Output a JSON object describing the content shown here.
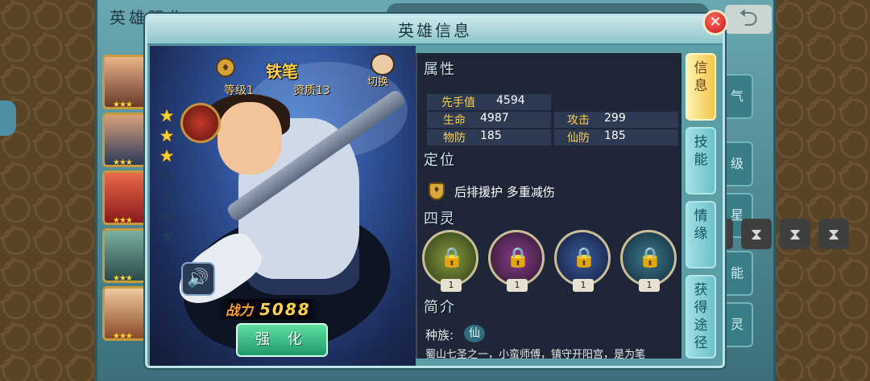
{
  "background_screen": {
    "title": "英雄强化",
    "side_labels": [
      "气",
      "级",
      "星",
      "能",
      "灵"
    ]
  },
  "dialog": {
    "title": "英雄信息",
    "close_label": "✕"
  },
  "hero": {
    "name": "铁笔",
    "level_text": "等级1",
    "quality_text": "资质13",
    "switch_label": "切换",
    "stars_total": 7,
    "stars_filled": 3,
    "power_label": "战力",
    "power_value": "5088",
    "enhance_label": "强 化"
  },
  "attributes": {
    "section_title": "属性",
    "first_strike_label": "先手值",
    "first_strike_value": "4594",
    "hp_label": "生命",
    "hp_value": "4987",
    "attack_label": "攻击",
    "attack_value": "299",
    "phys_def_label": "物防",
    "phys_def_value": "185",
    "magic_def_label": "仙防",
    "magic_def_value": "185"
  },
  "positioning": {
    "section_title": "定位",
    "text": "后排援护  多重减伤"
  },
  "spirits": {
    "section_title": "四灵",
    "slots": [
      {
        "count": "1",
        "color": "#5a6a2a"
      },
      {
        "count": "1",
        "color": "#5a2a5a"
      },
      {
        "count": "1",
        "color": "#1e3a6a"
      },
      {
        "count": "1",
        "color": "#1e4a5a"
      }
    ]
  },
  "intro": {
    "section_title": "简介",
    "race_label": "种族:",
    "race_value": "仙",
    "text": "蜀山七圣之一，小蛮师傅，镇守开阳宫，是为笔"
  },
  "tabs": [
    {
      "label": "信息",
      "active": true
    },
    {
      "label": "技能",
      "active": false
    },
    {
      "label": "情缘",
      "active": false
    },
    {
      "label": "获得途径",
      "active": false
    }
  ],
  "icons": {
    "sound": "speaker-icon",
    "lock": "lock-icon",
    "hourglass": "hourglass-icon"
  }
}
